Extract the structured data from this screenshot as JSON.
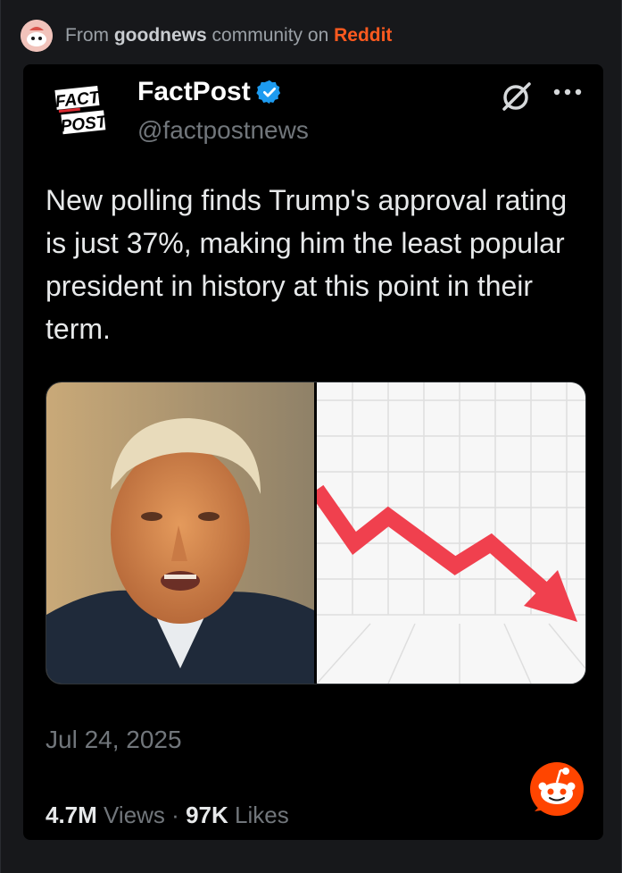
{
  "source": {
    "prefix": "From",
    "community": "goodnews",
    "middle": "community on",
    "platform": "Reddit"
  },
  "tweet": {
    "author_name": "FactPost",
    "handle": "@factpostnews",
    "logo_line1": "FACT",
    "logo_line2": "POST",
    "text": "New polling finds Trump's approval rating is just 37%, making him the least popular president in history at this point in their term.",
    "date": "Jul 24, 2025",
    "views_count": "4.7M",
    "views_label": "Views",
    "separator": "·",
    "likes_count": "97K",
    "likes_label": "Likes"
  },
  "icons": {
    "verified": "verified-badge-icon",
    "grok": "grok-icon",
    "more": "more-icon",
    "reddit": "reddit-snoo-icon"
  },
  "colors": {
    "background": "#17181b",
    "card": "#000000",
    "reddit": "#ff5a1f",
    "verified": "#1d9bf0",
    "chart_arrow": "#f0404e"
  }
}
